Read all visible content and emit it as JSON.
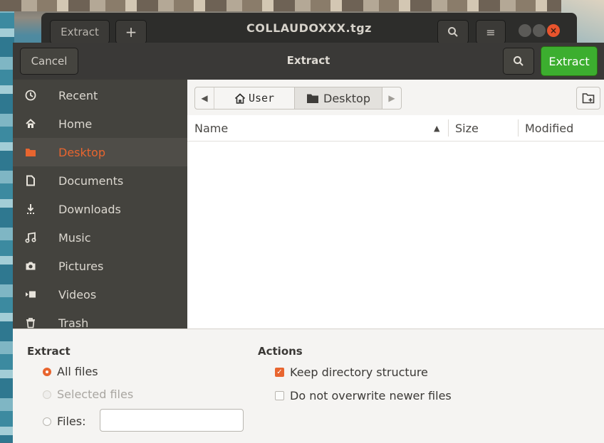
{
  "back_window": {
    "tab_label": "Extract",
    "new_tab_symbol": "+",
    "title": "COLLAUDOXXX.tgz",
    "close_symbol": "×"
  },
  "dialog": {
    "cancel_label": "Cancel",
    "title": "Extract",
    "extract_label": "Extract",
    "accent_color": "#e8652f",
    "extract_button_color": "#3cae2f"
  },
  "sidebar": {
    "items": [
      {
        "label": "Recent",
        "icon": "clock-icon"
      },
      {
        "label": "Home",
        "icon": "home-icon"
      },
      {
        "label": "Desktop",
        "icon": "folder-icon",
        "active": true
      },
      {
        "label": "Documents",
        "icon": "document-icon"
      },
      {
        "label": "Downloads",
        "icon": "download-icon"
      },
      {
        "label": "Music",
        "icon": "music-icon"
      },
      {
        "label": "Pictures",
        "icon": "camera-icon"
      },
      {
        "label": "Videos",
        "icon": "video-icon"
      },
      {
        "label": "Trash",
        "icon": "trash-icon"
      }
    ]
  },
  "path_bar": {
    "crumbs": [
      {
        "label": "User",
        "icon": "home-icon"
      },
      {
        "label": "Desktop",
        "icon": "folder-icon",
        "selected": true
      }
    ]
  },
  "file_list": {
    "columns": {
      "name": "Name",
      "size": "Size",
      "modified": "Modified"
    },
    "sort_column": "Name",
    "rows": []
  },
  "options": {
    "extract": {
      "title": "Extract",
      "all_files": "All files",
      "selected_files": "Selected files",
      "files": "Files:",
      "files_value": "",
      "selected_option": "All files"
    },
    "actions": {
      "title": "Actions",
      "keep_structure": "Keep directory structure",
      "keep_structure_checked": true,
      "no_overwrite": "Do not overwrite newer files",
      "no_overwrite_checked": false
    }
  }
}
